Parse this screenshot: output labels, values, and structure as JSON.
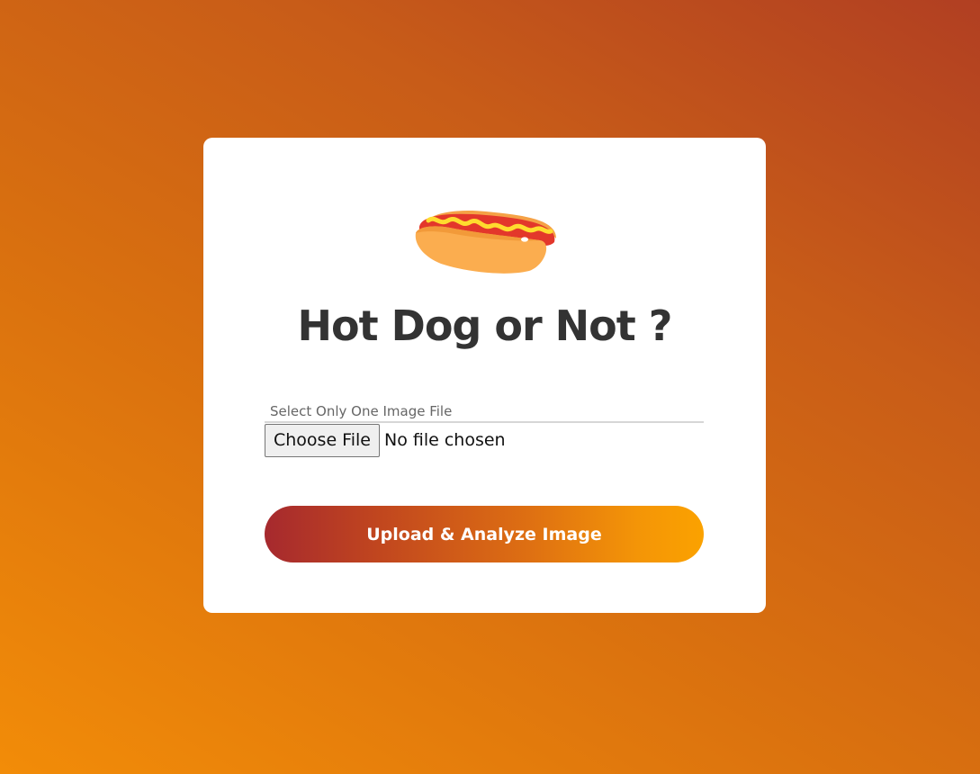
{
  "card": {
    "logo_icon": "hot-dog-icon",
    "title": "Hot Dog or Not ?"
  },
  "upload_form": {
    "field_label": "Select Only One Image File",
    "choose_button_label": "Choose File",
    "file_status": "No file chosen",
    "submit_label": "Upload & Analyze Image"
  },
  "colors": {
    "background_start": "#f28c08",
    "background_end": "#b13f22",
    "title": "#333333",
    "button_gradient_start": "#a6292e",
    "button_gradient_end": "#fba200"
  }
}
